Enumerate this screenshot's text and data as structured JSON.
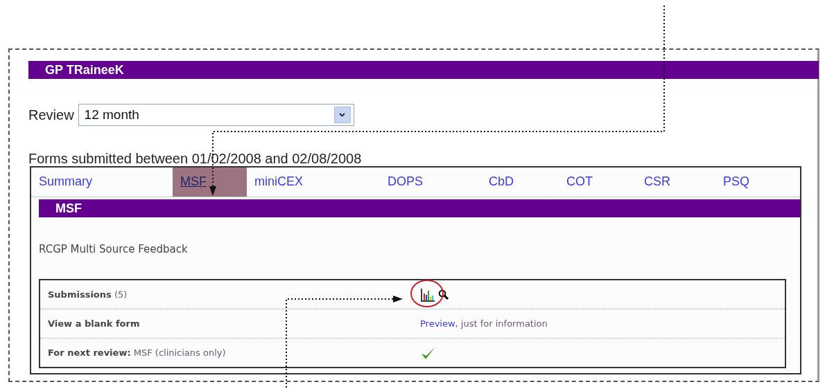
{
  "user_bar": {
    "title": "GP TRaineeK"
  },
  "review": {
    "label": "Review",
    "value": "12 month"
  },
  "period": "Forms submitted between 01/02/2008 and 02/08/2008",
  "tabs": [
    {
      "label": "Summary",
      "selected": false
    },
    {
      "label": "MSF",
      "selected": true
    },
    {
      "label": "miniCEX",
      "selected": false
    },
    {
      "label": "DOPS",
      "selected": false
    },
    {
      "label": "CbD",
      "selected": false
    },
    {
      "label": "COT",
      "selected": false
    },
    {
      "label": "CSR",
      "selected": false
    },
    {
      "label": "PSQ",
      "selected": false
    }
  ],
  "section": {
    "title": "MSF",
    "description": "RCGP Multi Source Feedback"
  },
  "rows": [
    {
      "kind": "tools",
      "label": "**Submissions** (5)",
      "highlighted": true
    },
    {
      "kind": "link",
      "label": "**View a blank form**",
      "link": "Preview",
      "text": ", just for information"
    },
    {
      "kind": "check",
      "label": "**For next review:** MSF (clinicians only)",
      "checked": true
    }
  ]
}
